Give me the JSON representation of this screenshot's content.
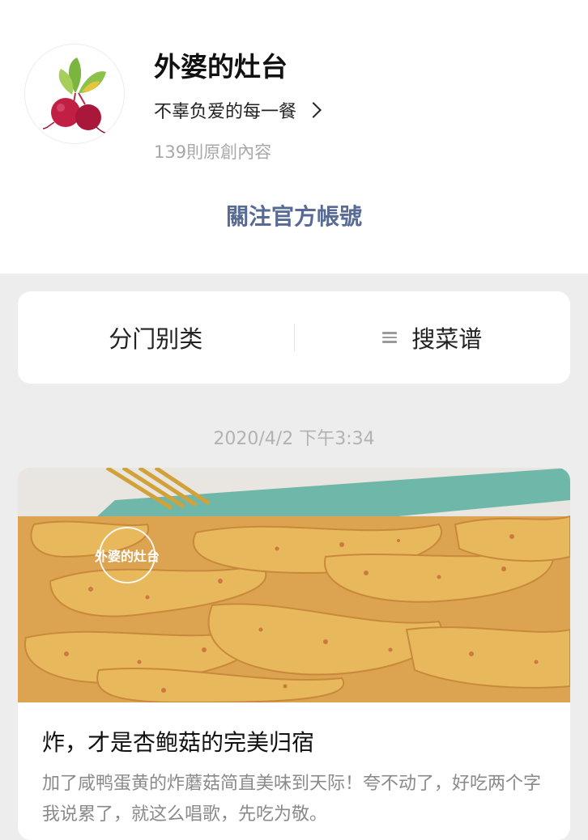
{
  "account": {
    "name": "外婆的灶台",
    "description": "不辜负爱的每一餐",
    "article_count": "139則原創內容",
    "follow_label": "關注官方帳號",
    "avatar_icon": "beetroot-icon"
  },
  "menu": {
    "items": [
      {
        "label": "分门别类"
      },
      {
        "label": "搜菜谱",
        "icon": "list-icon"
      }
    ]
  },
  "timestamp": "2020/4/2 下午3:34",
  "article": {
    "cover_watermark": "外婆的灶台",
    "title": "炸，才是杏鲍菇的完美归宿",
    "digest": "加了咸鸭蛋黄的炸蘑菇简直美味到天际！夸不动了，好吃两个字我说累了，就这么唱歌，先吃为敬。"
  },
  "colors": {
    "link_blue": "#576b95",
    "background": "#ededed",
    "card": "#ffffff",
    "muted_text": "#b2b2b2"
  }
}
